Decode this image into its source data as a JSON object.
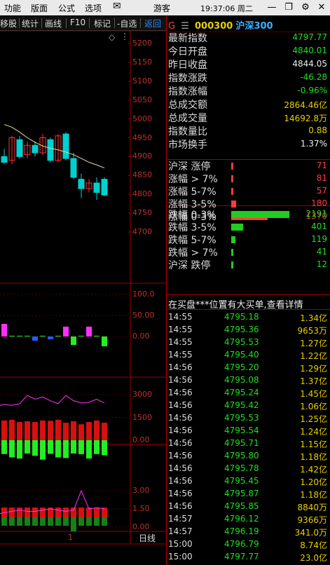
{
  "menu": {
    "items": [
      "功能",
      "版面",
      "公式",
      "选项"
    ],
    "mail_icon": "mail-icon",
    "guest": "游客",
    "clock": "19:37:06 周二",
    "controls": [
      "—",
      "❐",
      "✕"
    ]
  },
  "toolbar": {
    "items": [
      "移股",
      "统计",
      "画线",
      "F10",
      "标记",
      "-自选",
      "返回"
    ]
  },
  "stock": {
    "flag": "G",
    "menu_glyph": "☰",
    "code": "000300",
    "name": "沪深300"
  },
  "summary": [
    {
      "label": "最新指数",
      "value": "4797.77",
      "color": "green"
    },
    {
      "label": "今日开盘",
      "value": "4840.01",
      "color": "green"
    },
    {
      "label": "昨日收盘",
      "value": "4844.05",
      "color": "white"
    },
    {
      "label": "指数涨跌",
      "value": "-46.28",
      "color": "green"
    },
    {
      "label": "指数涨幅",
      "value": "-0.96%",
      "color": "green"
    },
    {
      "label": "总成交额",
      "value": "2864.46亿",
      "color": "yellow"
    },
    {
      "label": "总成交量",
      "value": "14692.8万",
      "color": "yellow"
    },
    {
      "label": "指数量比",
      "value": "0.88",
      "color": "yellow"
    },
    {
      "label": "市场换手",
      "value": "1.37%",
      "color": "white"
    }
  ],
  "breadth_up": [
    {
      "label": "沪深 涨停",
      "value": "71",
      "fraction": 0.04
    },
    {
      "label": "涨幅 > 7%",
      "value": "81",
      "fraction": 0.04
    },
    {
      "label": "涨幅 5-7%",
      "value": "57",
      "fraction": 0.03
    },
    {
      "label": "涨幅 3-5%",
      "value": "180",
      "fraction": 0.09
    },
    {
      "label": "涨幅 0-3%",
      "value": "1370",
      "fraction": 0.63
    }
  ],
  "breadth_down": [
    {
      "label": "跌幅 0-3%",
      "value": "2191",
      "fraction": 1.0
    },
    {
      "label": "跌幅 3-5%",
      "value": "401",
      "fraction": 0.2
    },
    {
      "label": "跌幅 5-7%",
      "value": "119",
      "fraction": 0.07
    },
    {
      "label": "跌幅 > 7%",
      "value": "41",
      "fraction": 0.02
    },
    {
      "label": "沪深 跌停",
      "value": "12",
      "fraction": 0.01
    }
  ],
  "notice": "在买盘***位置有大买单,查看详情",
  "ticks": [
    {
      "time": "14:55",
      "price": "4795.18",
      "vol": "1.34亿"
    },
    {
      "time": "14:55",
      "price": "4795.36",
      "vol": "9653万"
    },
    {
      "time": "14:55",
      "price": "4795.53",
      "vol": "1.27亿"
    },
    {
      "time": "14:55",
      "price": "4795.40",
      "vol": "1.22亿"
    },
    {
      "time": "14:56",
      "price": "4795.20",
      "vol": "1.29亿"
    },
    {
      "time": "14:56",
      "price": "4795.08",
      "vol": "1.37亿"
    },
    {
      "time": "14:56",
      "price": "4795.24",
      "vol": "1.45亿"
    },
    {
      "time": "14:56",
      "price": "4795.42",
      "vol": "1.06亿"
    },
    {
      "time": "14:56",
      "price": "4795.53",
      "vol": "1.25亿"
    },
    {
      "time": "14:56",
      "price": "4795.54",
      "vol": "1.24亿"
    },
    {
      "time": "14:56",
      "price": "4795.71",
      "vol": "1.15亿"
    },
    {
      "time": "14:56",
      "price": "4795.80",
      "vol": "1.18亿"
    },
    {
      "time": "14:56",
      "price": "4795.78",
      "vol": "1.42亿"
    },
    {
      "time": "14:56",
      "price": "4795.45",
      "vol": "1.20亿"
    },
    {
      "time": "14:56",
      "price": "4795.87",
      "vol": "1.18亿"
    },
    {
      "time": "14:56",
      "price": "4795.85",
      "vol": "8840万"
    },
    {
      "time": "14:57",
      "price": "4796.12",
      "vol": "9366万"
    },
    {
      "time": "14:57",
      "price": "4796.19",
      "vol": "341.0万"
    },
    {
      "time": "15:00",
      "price": "4796.79",
      "vol": "8.74亿"
    },
    {
      "time": "15:00",
      "price": "4797.77",
      "vol": "23.0亿"
    }
  ],
  "chart": {
    "diamond_icon": "diamond-icon",
    "price_axis": [
      "5200",
      "5150",
      "5100",
      "5050",
      "5000",
      "4950",
      "4900",
      "4850",
      "4800",
      "4750",
      "4700"
    ],
    "ind1_axis": [
      "100.0",
      "50.00",
      "0.00"
    ],
    "ind2_axis": [
      "3000",
      "1500",
      "0.00"
    ],
    "ind3_axis": [
      "3.00",
      "1.50",
      "0.00"
    ],
    "period": "日线",
    "x_marker": "1",
    "colors": {
      "up": "#ff3030",
      "down": "#00d0d0",
      "ma": "#e8e0a0",
      "magenta": "#ff30ff",
      "green": "#22ee22",
      "blue": "#2060ff"
    }
  },
  "chart_data": {
    "type": "candlestick",
    "period": "日线",
    "ylim": [
      4700,
      5200
    ],
    "candles": [
      {
        "o": 4900,
        "h": 4920,
        "l": 4880,
        "c": 4885,
        "up": false
      },
      {
        "o": 4890,
        "h": 4955,
        "l": 4880,
        "c": 4950,
        "up": true
      },
      {
        "o": 4945,
        "h": 4955,
        "l": 4895,
        "c": 4900,
        "up": false
      },
      {
        "o": 4905,
        "h": 4940,
        "l": 4895,
        "c": 4930,
        "up": true
      },
      {
        "o": 4930,
        "h": 4940,
        "l": 4900,
        "c": 4910,
        "up": false
      },
      {
        "o": 4910,
        "h": 4960,
        "l": 4905,
        "c": 4950,
        "up": true
      },
      {
        "o": 4945,
        "h": 4950,
        "l": 4885,
        "c": 4890,
        "up": false
      },
      {
        "o": 4890,
        "h": 4960,
        "l": 4885,
        "c": 4955,
        "up": true
      },
      {
        "o": 4960,
        "h": 4965,
        "l": 4890,
        "c": 4895,
        "up": false
      },
      {
        "o": 4895,
        "h": 4910,
        "l": 4840,
        "c": 4845,
        "up": false
      },
      {
        "o": 4840,
        "h": 4855,
        "l": 4790,
        "c": 4815,
        "up": false
      },
      {
        "o": 4815,
        "h": 4840,
        "l": 4805,
        "c": 4830,
        "up": true
      },
      {
        "o": 4830,
        "h": 4845,
        "l": 4785,
        "c": 4805,
        "up": false
      },
      {
        "o": 4840,
        "h": 4845,
        "l": 4795,
        "c": 4798,
        "up": false
      }
    ],
    "ma_line": [
      4985,
      4978,
      4965,
      4950,
      4938,
      4928,
      4922,
      4918,
      4912,
      4905,
      4895,
      4885,
      4878,
      4870
    ],
    "indicator1": [
      18,
      0,
      0,
      0,
      -6,
      0,
      -4,
      0,
      14,
      -12,
      0,
      14,
      0,
      -14
    ],
    "volume_bars": [
      1300,
      1350,
      1200,
      1250,
      1200,
      1300,
      1280,
      1350,
      1150,
      1250,
      1050,
      1200,
      1300,
      1150
    ],
    "volume_line": [
      2350,
      2300,
      2400,
      2950,
      2700,
      2850,
      2600,
      2400,
      2950,
      2600,
      2450,
      2500,
      2700,
      2450
    ],
    "indicator3": [
      1.2,
      1.3,
      1.4,
      1.3,
      1.3,
      1.4,
      1.5,
      1.4,
      1.3,
      1.4,
      3.0,
      1.5,
      1.6,
      1.5
    ]
  }
}
